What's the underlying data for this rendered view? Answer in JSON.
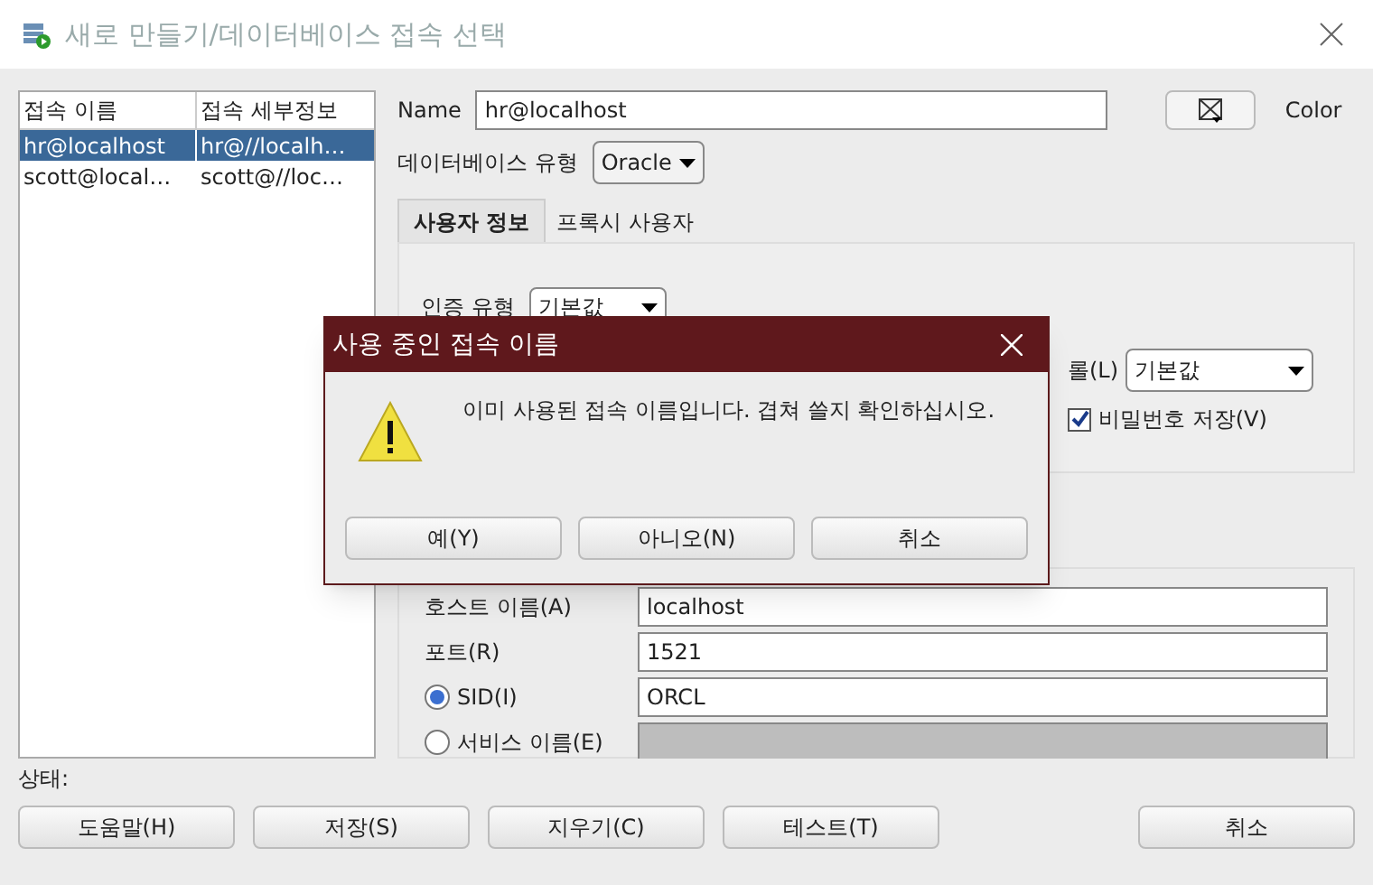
{
  "window": {
    "title": "새로 만들기/데이터베이스 접속 선택"
  },
  "connections": {
    "columns": [
      "접속 이름",
      "접속 세부정보"
    ],
    "rows": [
      {
        "name": "hr@localhost",
        "details": "hr@//localh…",
        "selected": true
      },
      {
        "name": "scott@local…",
        "details": "scott@//loc…",
        "selected": false
      }
    ]
  },
  "form": {
    "name_label": "Name",
    "name_value": "hr@localhost",
    "color_label": "Color",
    "db_type_label": "데이터베이스 유형",
    "db_type": "Oracle",
    "tabs": [
      {
        "label": "사용자 정보",
        "selected": true
      },
      {
        "label": "프록시 사용자",
        "selected": false
      }
    ],
    "auth_label": "인증 유형",
    "auth_value": "기본값",
    "role_label": "롤(L)",
    "role_value": "기본값",
    "save_password": {
      "label": "비밀번호 저장(V)",
      "checked": true
    },
    "host_label": "호스트 이름(A)",
    "host": "localhost",
    "port_label": "포트(R)",
    "port": "1521",
    "sid": {
      "label": "SID(I)",
      "selected": true,
      "value": "ORCL"
    },
    "service": {
      "label": "서비스 이름(E)",
      "selected": false
    }
  },
  "status_label": "상태:",
  "buttons": [
    "도움말(H)",
    "저장(S)",
    "지우기(C)",
    "테스트(T)"
  ],
  "cancel": "취소",
  "dialog": {
    "title": "사용 중인 접속 이름",
    "message": "이미 사용된 접속 이름입니다. 겹쳐 쓸지 확인하십시오.",
    "buttons": [
      "예(Y)",
      "아니오(N)",
      "취소"
    ]
  }
}
